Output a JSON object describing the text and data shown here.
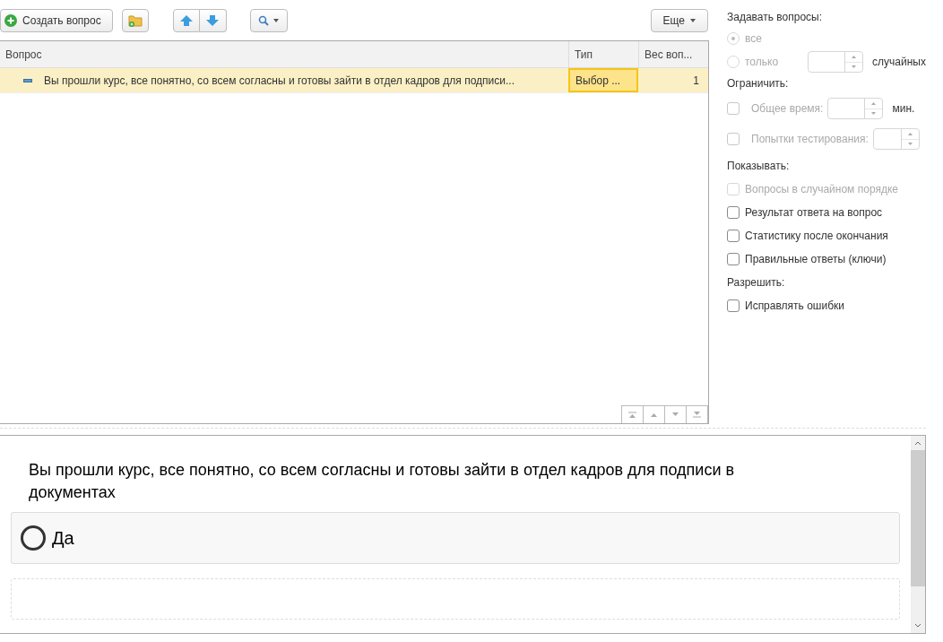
{
  "toolbar": {
    "create_label": "Создать вопрос",
    "more_label": "Еще"
  },
  "table": {
    "columns": [
      "Вопрос",
      "Тип",
      "Вес воп..."
    ],
    "rows": [
      {
        "question": "Вы прошли курс, все понятно, со всем согласны и готовы зайти в отдел кадров для подписи...",
        "type": "Выбор ...",
        "weight": "1",
        "selected": true
      }
    ]
  },
  "settings": {
    "ask_label": "Задавать вопросы:",
    "ask_options": [
      {
        "label": "все",
        "selected": true,
        "disabled": true
      },
      {
        "label": "только",
        "selected": false,
        "disabled": true,
        "suffix": "случайных"
      }
    ],
    "limit_label": "Ограничить:",
    "limits": [
      {
        "label": "Общее время:",
        "checked": false,
        "disabled": true,
        "unit": "мин."
      },
      {
        "label": "Попытки тестирования:",
        "checked": false,
        "disabled": true
      }
    ],
    "show_label": "Показывать:",
    "show_options": [
      {
        "label": "Вопросы в случайном порядке",
        "checked": false,
        "disabled": true
      },
      {
        "label": "Результат ответа на вопрос",
        "checked": false,
        "disabled": false
      },
      {
        "label": "Статистику после окончания",
        "checked": false,
        "disabled": false
      },
      {
        "label": "Правильные ответы (ключи)",
        "checked": false,
        "disabled": false
      }
    ],
    "allow_label": "Разрешить:",
    "allow_options": [
      {
        "label": "Исправлять ошибки",
        "checked": false,
        "disabled": false
      }
    ]
  },
  "preview": {
    "question": "Вы прошли курс, все понятно, со всем согласны и готовы зайти в отдел кадров для подписи в документах",
    "answers": [
      {
        "label": "Да",
        "selected": false
      }
    ]
  }
}
